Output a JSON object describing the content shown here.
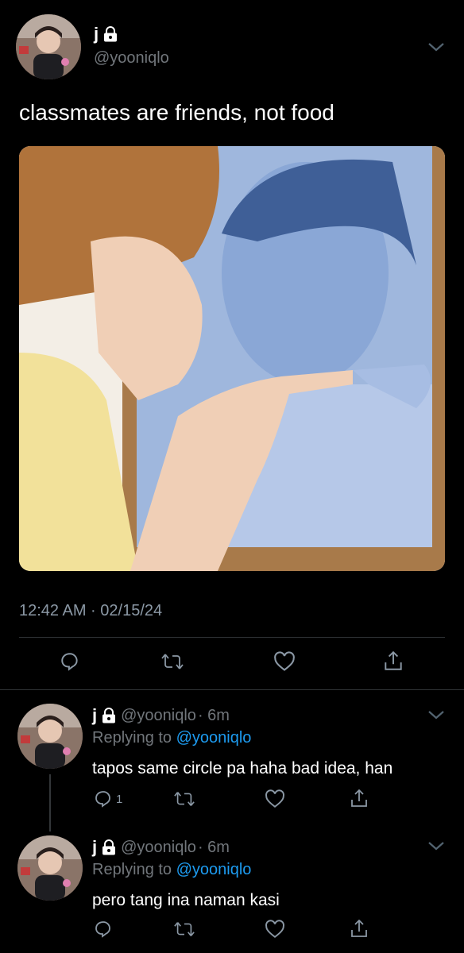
{
  "main_tweet": {
    "display_name": "j",
    "handle": "@yooniqlo",
    "text": "classmates are friends, not food",
    "timestamp": "12:42 AM · 02/15/24"
  },
  "replies": [
    {
      "display_name": "j",
      "handle": "@yooniqlo",
      "time": "· 6m",
      "replying_label": "Replying to",
      "replying_to": "@yooniqlo",
      "text": "tapos same circle pa haha bad idea, han",
      "reply_count": "1"
    },
    {
      "display_name": "j",
      "handle": "@yooniqlo",
      "time": "· 6m",
      "replying_label": "Replying to",
      "replying_to": "@yooniqlo",
      "text": "pero tang ina naman kasi",
      "reply_count": ""
    }
  ],
  "icons": {
    "lock": "lock-icon",
    "chevron": "chevron-down-icon",
    "reply": "reply-icon",
    "retweet": "retweet-icon",
    "like": "heart-icon",
    "share": "share-icon"
  },
  "colors": {
    "background": "#000000",
    "text": "#e7e9ea",
    "muted": "#71767b",
    "link": "#1d9bf0",
    "divider": "#2f3336"
  }
}
